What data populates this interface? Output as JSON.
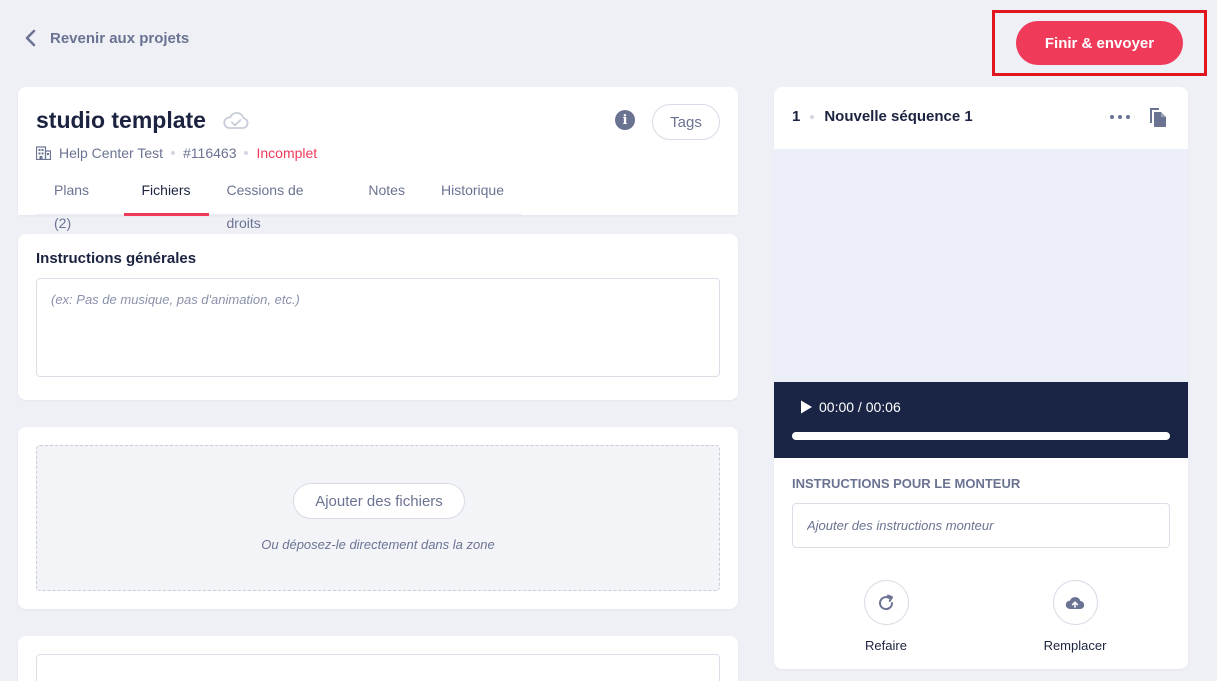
{
  "nav": {
    "back_label": "Revenir aux projets"
  },
  "header": {
    "finish_label": "Finir & envoyer"
  },
  "project": {
    "title": "studio template",
    "company": "Help Center Test",
    "id": "#116463",
    "status": "Incomplet",
    "tags_label": "Tags",
    "tabs": [
      {
        "label": "Plans (2)",
        "active": false
      },
      {
        "label": "Fichiers",
        "active": true
      },
      {
        "label": "Cessions de droits",
        "active": false
      },
      {
        "label": "Notes",
        "active": false
      },
      {
        "label": "Historique",
        "active": false
      }
    ]
  },
  "instructions": {
    "title": "Instructions générales",
    "placeholder": "(ex: Pas de musique, pas d'animation, etc.)",
    "value": ""
  },
  "files": {
    "add_label": "Ajouter des fichiers",
    "drop_hint": "Ou déposez-le directement dans la zone"
  },
  "sequence": {
    "number": "1",
    "name": "Nouvelle séquence 1",
    "player": {
      "time": "00:00 / 00:06",
      "progress": 0
    },
    "editor_title": "INSTRUCTIONS POUR LE MONTEUR",
    "editor_placeholder": "Ajouter des instructions monteur",
    "actions": {
      "redo_label": "Refaire",
      "replace_label": "Remplacer"
    }
  },
  "colors": {
    "accent": "#ef3a5a",
    "background": "#eef0f6",
    "player": "#1a2546",
    "highlight_box": "#e0161e"
  }
}
